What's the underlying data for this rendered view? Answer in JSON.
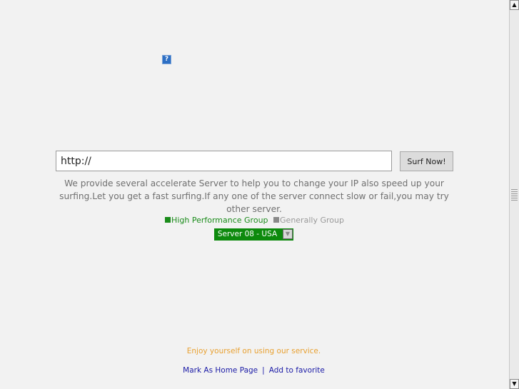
{
  "help_icon": {
    "glyph": "?"
  },
  "search": {
    "url_value": "http://",
    "button_label": "Surf Now!"
  },
  "description": "We provide several accelerate Server to help you to change your IP also speed up your surfing.Let you get a fast surfing.If any one of the server connect slow or fail,you may try other server.",
  "groups": {
    "high": {
      "label": "High Performance Group",
      "color": "#1b8c1b"
    },
    "general": {
      "label": "Generally Group",
      "color": "#999999"
    }
  },
  "server": {
    "selected": "Server 08 - USA",
    "accent": "#0d8a0d"
  },
  "footer": {
    "enjoy": "Enjoy yourself on using our service.",
    "home_link": "Mark As Home Page",
    "separator": "|",
    "favorite_link": "Add to favorite"
  },
  "scrollbar": {
    "up_glyph": "▲",
    "down_glyph": "▼"
  }
}
